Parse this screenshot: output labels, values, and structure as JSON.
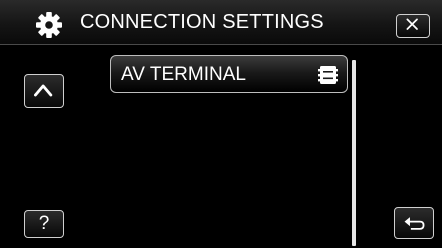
{
  "header": {
    "title": "CONNECTION SETTINGS",
    "icon": "gear-icon"
  },
  "buttons": {
    "close_icon": "close-icon",
    "scroll_up_icon": "chevron-up-icon",
    "help_label": "?",
    "back_icon": "return-icon"
  },
  "menu": {
    "items": [
      {
        "label": "AV TERMINAL",
        "icon": "av-terminal-icon"
      }
    ]
  },
  "colors": {
    "background": "#000000",
    "text": "#ffffff",
    "border": "#d0d0d0"
  }
}
